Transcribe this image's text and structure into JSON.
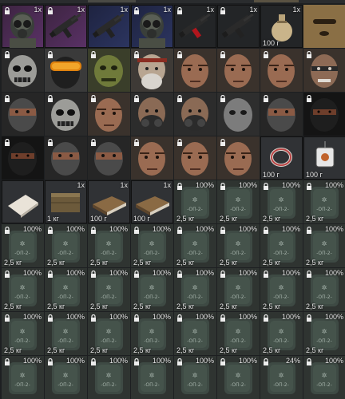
{
  "inventory": {
    "cells": [
      {
        "icon": "gasmask-soldier-icon",
        "bg": "purple",
        "qty": "1x",
        "weight": "",
        "locked": true
      },
      {
        "icon": "smg-icon",
        "bg": "purple",
        "qty": "1x",
        "weight": "",
        "locked": true
      },
      {
        "icon": "smg-icon",
        "bg": "blue",
        "qty": "1x",
        "weight": "",
        "locked": false
      },
      {
        "icon": "gasmask-soldier-icon",
        "bg": "blue",
        "qty": "1x",
        "weight": "",
        "locked": true
      },
      {
        "icon": "red-smg-icon",
        "bg": "dark",
        "qty": "1x",
        "weight": "",
        "locked": true
      },
      {
        "icon": "smg-icon",
        "bg": "dark",
        "qty": "1x",
        "weight": "",
        "locked": true
      },
      {
        "icon": "money-bag-icon",
        "bg": "dark",
        "qty": "1x",
        "weight": "100 г",
        "locked": false
      },
      {
        "icon": "balaclava-mask-icon",
        "bg": "gray",
        "qty": "",
        "weight": "",
        "locked": false
      },
      {
        "icon": "skull-mask-face-icon",
        "bg": "gray",
        "qty": "",
        "weight": "",
        "locked": true
      },
      {
        "icon": "goggles-face-icon",
        "bg": "gray",
        "qty": "",
        "weight": "",
        "locked": true
      },
      {
        "icon": "green-mask-face-icon",
        "bg": "gray",
        "qty": "",
        "weight": "",
        "locked": true
      },
      {
        "icon": "old-man-face-icon",
        "bg": "gray",
        "qty": "",
        "weight": "",
        "locked": true
      },
      {
        "icon": "man-face-icon",
        "bg": "gray",
        "qty": "",
        "weight": "",
        "locked": true
      },
      {
        "icon": "man-face-icon",
        "bg": "gray",
        "qty": "",
        "weight": "",
        "locked": true
      },
      {
        "icon": "man-face-icon",
        "bg": "gray",
        "qty": "",
        "weight": "",
        "locked": true
      },
      {
        "icon": "painted-face-icon",
        "bg": "gray",
        "qty": "",
        "weight": "",
        "locked": true
      },
      {
        "icon": "masked-face-icon",
        "bg": "gray",
        "qty": "",
        "weight": "",
        "locked": true
      },
      {
        "icon": "skull-mask-face-icon",
        "bg": "gray",
        "qty": "",
        "weight": "",
        "locked": true
      },
      {
        "icon": "man-face-icon",
        "bg": "gray",
        "qty": "",
        "weight": "",
        "locked": true
      },
      {
        "icon": "respirator-face-icon",
        "bg": "gray",
        "qty": "",
        "weight": "",
        "locked": true
      },
      {
        "icon": "respirator-face-icon",
        "bg": "gray",
        "qty": "",
        "weight": "",
        "locked": true
      },
      {
        "icon": "gray-mask-face-icon",
        "bg": "gray",
        "qty": "",
        "weight": "",
        "locked": true
      },
      {
        "icon": "masked-face-icon",
        "bg": "gray",
        "qty": "",
        "weight": "",
        "locked": true
      },
      {
        "icon": "balaclava-face-icon",
        "bg": "gray",
        "qty": "",
        "weight": "",
        "locked": true
      },
      {
        "icon": "balaclava-face-icon",
        "bg": "gray",
        "qty": "",
        "weight": "",
        "locked": true
      },
      {
        "icon": "masked-face-icon",
        "bg": "gray",
        "qty": "",
        "weight": "",
        "locked": true
      },
      {
        "icon": "masked-face-icon",
        "bg": "gray",
        "qty": "",
        "weight": "",
        "locked": true
      },
      {
        "icon": "man-face-icon",
        "bg": "gray",
        "qty": "",
        "weight": "",
        "locked": true
      },
      {
        "icon": "man-face-icon",
        "bg": "gray",
        "qty": "",
        "weight": "",
        "locked": true
      },
      {
        "icon": "man-face-icon",
        "bg": "gray",
        "qty": "",
        "weight": "",
        "locked": true
      },
      {
        "icon": "ring-icon",
        "bg": "gray",
        "qty": "",
        "weight": "100 г",
        "locked": false
      },
      {
        "icon": "dog-tag-icon",
        "bg": "gray",
        "qty": "",
        "weight": "100 г",
        "locked": false
      },
      {
        "icon": "paper-map-icon",
        "bg": "gray",
        "qty": "",
        "weight": "",
        "locked": false
      },
      {
        "icon": "wooden-crate-icon",
        "bg": "gray",
        "qty": "1x",
        "weight": "1 кг",
        "locked": false
      },
      {
        "icon": "book-icon",
        "bg": "gray",
        "qty": "1x",
        "weight": "100 г",
        "locked": false
      },
      {
        "icon": "book-icon",
        "bg": "gray",
        "qty": "1x",
        "weight": "100 г",
        "locked": false
      },
      {
        "icon": "armor-plate-icon",
        "bg": "gray",
        "qty": "100%",
        "weight": "2,5 кг",
        "locked": true
      },
      {
        "icon": "armor-plate-icon",
        "bg": "gray",
        "qty": "100%",
        "weight": "2,5 кг",
        "locked": true
      },
      {
        "icon": "armor-plate-icon",
        "bg": "gray",
        "qty": "100%",
        "weight": "2,5 кг",
        "locked": true
      },
      {
        "icon": "armor-plate-icon",
        "bg": "gray",
        "qty": "100%",
        "weight": "2,5 кг",
        "locked": true
      },
      {
        "icon": "armor-plate-icon",
        "bg": "gray",
        "qty": "100%",
        "weight": "2,5 кг",
        "locked": true
      },
      {
        "icon": "armor-plate-icon",
        "bg": "gray",
        "qty": "100%",
        "weight": "2,5 кг",
        "locked": true
      },
      {
        "icon": "armor-plate-icon",
        "bg": "gray",
        "qty": "100%",
        "weight": "2,5 кг",
        "locked": true
      },
      {
        "icon": "armor-plate-icon",
        "bg": "gray",
        "qty": "100%",
        "weight": "2,5 кг",
        "locked": true
      },
      {
        "icon": "armor-plate-icon",
        "bg": "gray",
        "qty": "100%",
        "weight": "2,5 кг",
        "locked": true
      },
      {
        "icon": "armor-plate-icon",
        "bg": "gray",
        "qty": "100%",
        "weight": "2,5 кг",
        "locked": true
      },
      {
        "icon": "armor-plate-icon",
        "bg": "gray",
        "qty": "100%",
        "weight": "2,5 кг",
        "locked": true
      },
      {
        "icon": "armor-plate-icon",
        "bg": "gray",
        "qty": "100%",
        "weight": "2,5 кг",
        "locked": true
      },
      {
        "icon": "armor-plate-icon",
        "bg": "gray",
        "qty": "100%",
        "weight": "2,5 кг",
        "locked": true
      },
      {
        "icon": "armor-plate-icon",
        "bg": "gray",
        "qty": "100%",
        "weight": "2,5 кг",
        "locked": true
      },
      {
        "icon": "armor-plate-icon",
        "bg": "gray",
        "qty": "100%",
        "weight": "2,5 кг",
        "locked": true
      },
      {
        "icon": "armor-plate-icon",
        "bg": "gray",
        "qty": "100%",
        "weight": "2,5 кг",
        "locked": true
      },
      {
        "icon": "armor-plate-icon",
        "bg": "gray",
        "qty": "100%",
        "weight": "2,5 кг",
        "locked": true
      },
      {
        "icon": "armor-plate-icon",
        "bg": "gray",
        "qty": "100%",
        "weight": "2,5 кг",
        "locked": true
      },
      {
        "icon": "armor-plate-icon",
        "bg": "gray",
        "qty": "100%",
        "weight": "2,5 кг",
        "locked": true
      },
      {
        "icon": "armor-plate-icon",
        "bg": "gray",
        "qty": "100%",
        "weight": "2,5 кг",
        "locked": true
      },
      {
        "icon": "armor-plate-icon",
        "bg": "gray",
        "qty": "100%",
        "weight": "2,5 кг",
        "locked": true
      },
      {
        "icon": "armor-plate-icon",
        "bg": "gray",
        "qty": "100%",
        "weight": "2,5 кг",
        "locked": true
      },
      {
        "icon": "armor-plate-icon",
        "bg": "gray",
        "qty": "100%",
        "weight": "2,5 кг",
        "locked": true
      },
      {
        "icon": "armor-plate-icon",
        "bg": "gray",
        "qty": "100%",
        "weight": "2,5 кг",
        "locked": true
      },
      {
        "icon": "armor-plate-icon",
        "bg": "gray",
        "qty": "100%",
        "weight": "2,5 кг",
        "locked": true
      },
      {
        "icon": "armor-plate-icon",
        "bg": "gray",
        "qty": "100%",
        "weight": "2,5 кг",
        "locked": true
      },
      {
        "icon": "armor-plate-icon",
        "bg": "gray",
        "qty": "100%",
        "weight": "2,5 кг",
        "locked": true
      },
      {
        "icon": "armor-plate-icon",
        "bg": "gray",
        "qty": "100%",
        "weight": "2,5 кг",
        "locked": true
      },
      {
        "icon": "armor-plate-icon",
        "bg": "gray",
        "qty": "100%",
        "weight": "",
        "locked": true
      },
      {
        "icon": "armor-plate-icon",
        "bg": "gray",
        "qty": "100%",
        "weight": "",
        "locked": true
      },
      {
        "icon": "armor-plate-icon",
        "bg": "gray",
        "qty": "100%",
        "weight": "",
        "locked": true
      },
      {
        "icon": "armor-plate-icon",
        "bg": "gray",
        "qty": "100%",
        "weight": "",
        "locked": true
      },
      {
        "icon": "armor-plate-icon",
        "bg": "gray",
        "qty": "100%",
        "weight": "",
        "locked": true
      },
      {
        "icon": "armor-plate-icon",
        "bg": "gray",
        "qty": "100%",
        "weight": "",
        "locked": true
      },
      {
        "icon": "armor-plate-icon",
        "bg": "gray",
        "qty": "24%",
        "weight": "",
        "locked": true
      },
      {
        "icon": "armor-plate-icon",
        "bg": "gray",
        "qty": "100%",
        "weight": "",
        "locked": true
      }
    ]
  }
}
